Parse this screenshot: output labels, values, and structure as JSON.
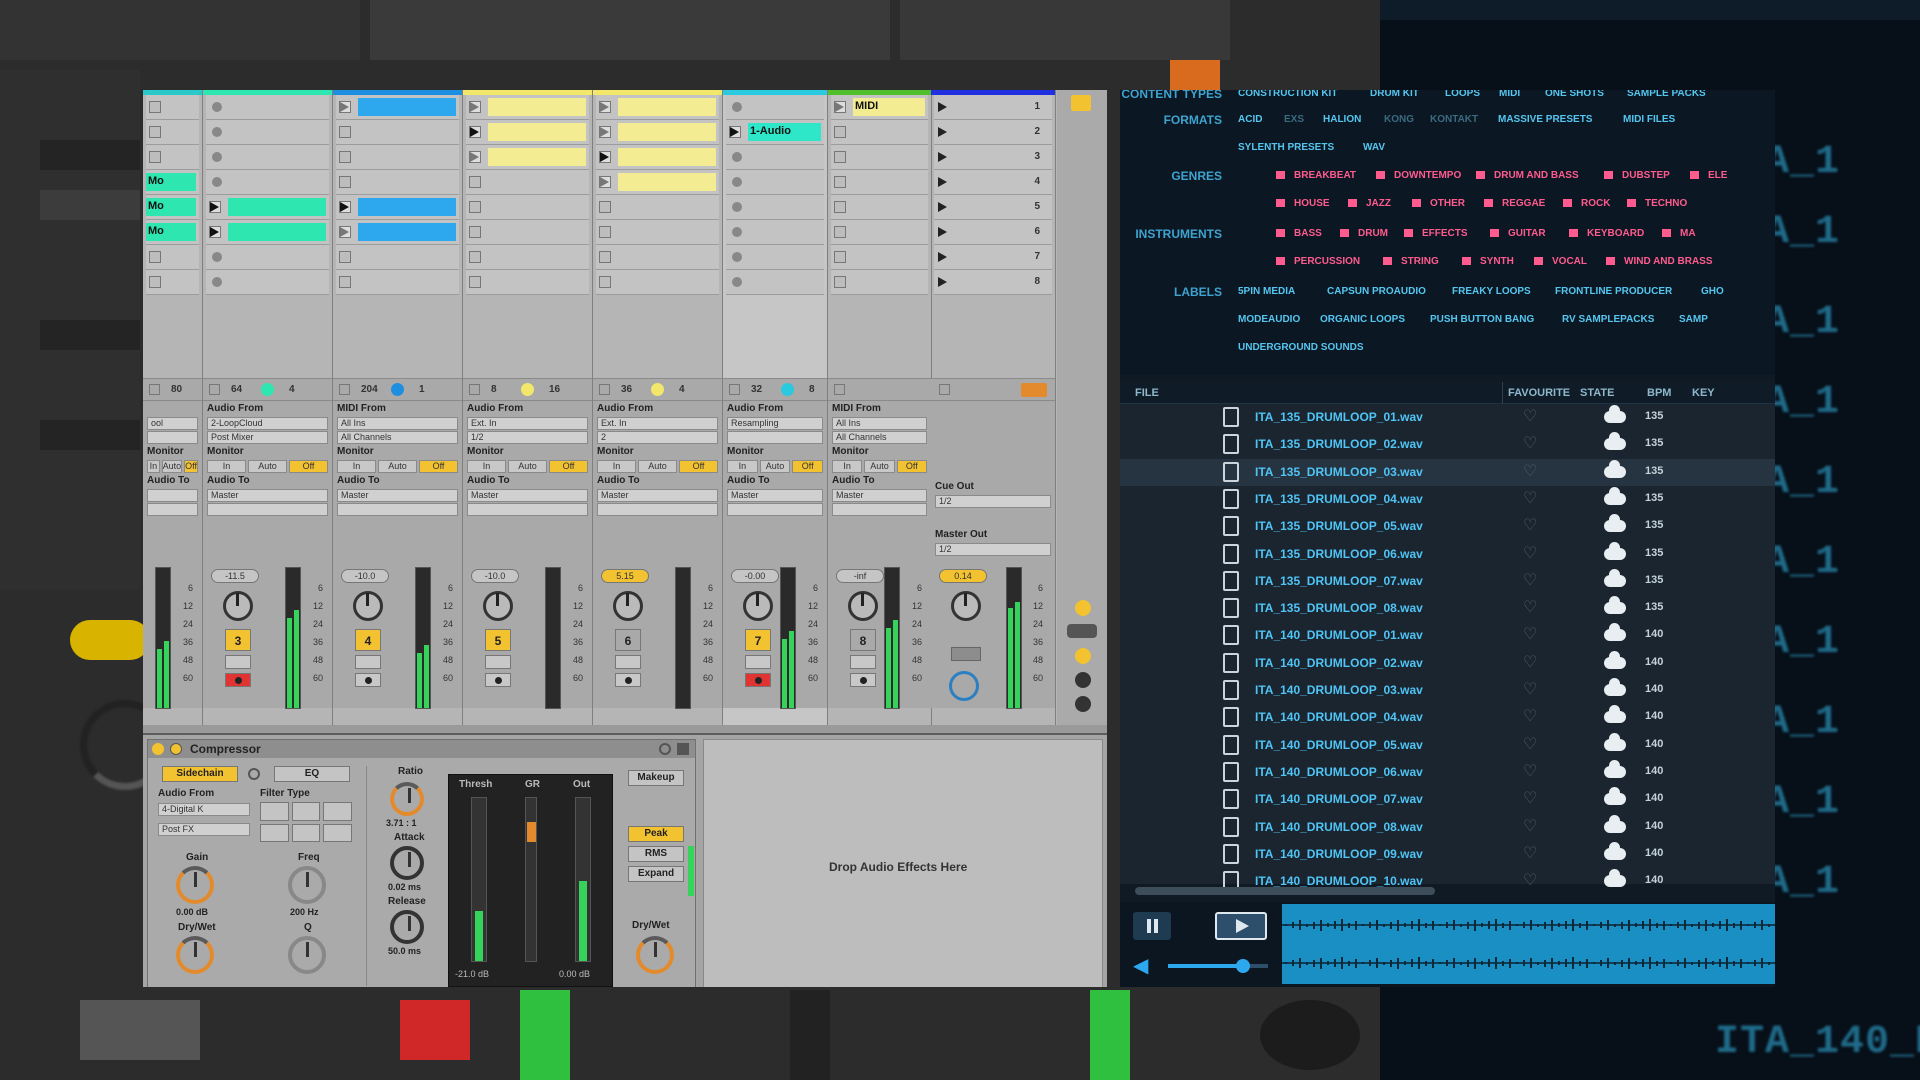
{
  "tracks": [
    {
      "color": "#29c9c9",
      "slots": [
        {
          "type": "empty"
        },
        {
          "type": "empty"
        },
        {
          "type": "empty"
        },
        {
          "type": "clip",
          "color": "#2ee6b0",
          "label": "Mo"
        },
        {
          "type": "clip",
          "color": "#2ee6b0",
          "label": "Mo"
        },
        {
          "type": "clip",
          "color": "#2ee6b0",
          "label": "Mo"
        },
        {
          "type": "empty"
        },
        {
          "type": "empty"
        }
      ],
      "header_num": "80",
      "input_label": "",
      "input_dd": "ool",
      "channel_dd": "",
      "to_dd": "",
      "volume": "",
      "track_num": "",
      "armed": false
    },
    {
      "color": "#2ee6b0",
      "slots": [
        {
          "type": "stop"
        },
        {
          "type": "stop"
        },
        {
          "type": "stop"
        },
        {
          "type": "stop"
        },
        {
          "type": "play",
          "color": "#2ee6b0"
        },
        {
          "type": "play",
          "color": "#2ee6b0"
        },
        {
          "type": "stop"
        },
        {
          "type": "stop"
        }
      ],
      "header_num": "64",
      "header_num2": "4",
      "input_label": "Audio From",
      "input_dd": "2-LoopCloud",
      "channel_dd": "Post Mixer",
      "to_dd": "Master",
      "volume": "-11.5",
      "track_num": "3",
      "armed": true
    },
    {
      "color": "#1e8fe0",
      "slots": [
        {
          "type": "btn",
          "color": "#2da8ee"
        },
        {
          "type": "empty"
        },
        {
          "type": "empty"
        },
        {
          "type": "empty"
        },
        {
          "type": "play",
          "color": "#2da8ee"
        },
        {
          "type": "btn",
          "color": "#2da8ee"
        },
        {
          "type": "empty"
        },
        {
          "type": "empty"
        }
      ],
      "header_num": "204",
      "header_num2": "1",
      "input_label": "MIDI From",
      "input_dd": "All Ins",
      "channel_dd": "All Channels",
      "to_dd": "Master",
      "volume": "-10.0",
      "track_num": "4",
      "armed": false
    },
    {
      "color": "#f2e66b",
      "slots": [
        {
          "type": "btn",
          "color": "#f4ec93"
        },
        {
          "type": "play",
          "color": "#f4ec93"
        },
        {
          "type": "btn",
          "color": "#f4ec93"
        },
        {
          "type": "empty"
        },
        {
          "type": "empty"
        },
        {
          "type": "empty"
        },
        {
          "type": "empty"
        },
        {
          "type": "empty"
        }
      ],
      "header_num": "8",
      "header_num2": "16",
      "input_label": "Audio From",
      "input_dd": "Ext. In",
      "channel_dd": "1/2",
      "to_dd": "Master",
      "volume": "-10.0",
      "track_num": "5",
      "armed": false
    },
    {
      "color": "#f2e66b",
      "slots": [
        {
          "type": "btn",
          "color": "#f4ec93"
        },
        {
          "type": "btn",
          "color": "#f4ec93"
        },
        {
          "type": "play",
          "color": "#f4ec93"
        },
        {
          "type": "btn",
          "color": "#f4ec93"
        },
        {
          "type": "empty"
        },
        {
          "type": "empty"
        },
        {
          "type": "empty"
        },
        {
          "type": "empty"
        }
      ],
      "header_num": "36",
      "header_num2": "4",
      "input_label": "Audio From",
      "input_dd": "Ext. In",
      "channel_dd": "2",
      "to_dd": "Master",
      "volume": "5.15",
      "track_num": "6",
      "armed": false
    },
    {
      "color": "#29c9e0",
      "slots": [
        {
          "type": "stop"
        },
        {
          "type": "play",
          "color": "#2ee6c8",
          "name": "1-Audio"
        },
        {
          "type": "stop"
        },
        {
          "type": "stop"
        },
        {
          "type": "stop"
        },
        {
          "type": "stop"
        },
        {
          "type": "stop"
        },
        {
          "type": "stop"
        }
      ],
      "header_num": "32",
      "header_num2": "8",
      "input_label": "Audio From",
      "input_dd": "Resampling",
      "channel_dd": "",
      "to_dd": "Master",
      "volume": "-0.00",
      "track_num": "7",
      "armed": true
    },
    {
      "color": "#4fbf2e",
      "slots": [
        {
          "type": "btn",
          "color": "#f4ec93",
          "name": "MIDI"
        },
        {
          "type": "empty"
        },
        {
          "type": "empty"
        },
        {
          "type": "empty"
        },
        {
          "type": "empty"
        },
        {
          "type": "empty"
        },
        {
          "type": "empty"
        },
        {
          "type": "empty"
        }
      ],
      "header_num": "",
      "header_num2": "",
      "input_label": "MIDI From",
      "input_dd": "All Ins",
      "channel_dd": "All Channels",
      "to_dd": "Master",
      "volume": "-inf",
      "track_num": "8",
      "armed": false
    }
  ],
  "master": {
    "color": "#2030e0",
    "scenes": [
      "1",
      "2",
      "3",
      "4",
      "5",
      "6",
      "7",
      "8"
    ],
    "cue_label": "Cue Out",
    "cue_dd": "1/2",
    "master_label": "Master Out",
    "master_dd": "1/2",
    "volume": "0.14"
  },
  "monitor": {
    "in": "In",
    "auto": "Auto",
    "off": "Off",
    "label": "Monitor",
    "to_label": "Audio To"
  },
  "scale": [
    "6",
    "12",
    "24",
    "36",
    "48",
    "60"
  ],
  "compressor": {
    "title": "Compressor",
    "sidechain": "Sidechain",
    "audio_from": "Audio From",
    "audio_from_dd": "4-Digital K",
    "post_dd": "Post FX",
    "filter_type": "Filter Type",
    "gain": "Gain",
    "gain_val": "0.00 dB",
    "drywet": "Dry/Wet",
    "freq": "Freq",
    "freq_val": "200 Hz",
    "q": "Q",
    "eq": "EQ",
    "ratio": "Ratio",
    "ratio_val": "3.71 : 1",
    "attack": "Attack",
    "attack_val": "0.02 ms",
    "release": "Release",
    "release_val": "50.0 ms",
    "thresh": "Thresh",
    "gr": "GR",
    "out": "Out",
    "thresh_val": "-21.0 dB",
    "out_val": "0.00 dB",
    "makeup": "Makeup",
    "peak": "Peak",
    "rms": "RMS",
    "expand": "Expand",
    "drywet2": "Dry/Wet"
  },
  "drop_text": "Drop Audio Effects Here",
  "browser": {
    "content_types": "CONTENT TYPES",
    "content_type_tags": [
      "CONSTRUCTION KIT",
      "DRUM KIT",
      "LOOPS",
      "MIDI",
      "ONE SHOTS",
      "SAMPLE PACKS"
    ],
    "formats": "FORMATS",
    "format_tags": [
      {
        "t": "ACID",
        "dim": false
      },
      {
        "t": "EXS",
        "dim": true
      },
      {
        "t": "HALION",
        "dim": false
      },
      {
        "t": "KONG",
        "dim": true
      },
      {
        "t": "KONTAKT",
        "dim": true
      },
      {
        "t": "MASSIVE PRESETS",
        "dim": false
      },
      {
        "t": "MIDI FILES",
        "dim": false
      }
    ],
    "format_tags2": [
      "SYLENTH PRESETS",
      "WAV"
    ],
    "genres": "GENRES",
    "genre_tags": [
      "BREAKBEAT",
      "DOWNTEMPO",
      "DRUM AND BASS",
      "DUBSTEP",
      "ELE"
    ],
    "genre_tags2": [
      "HOUSE",
      "JAZZ",
      "OTHER",
      "REGGAE",
      "ROCK",
      "TECHNO"
    ],
    "instruments": "INSTRUMENTS",
    "inst_tags": [
      "BASS",
      "DRUM",
      "EFFECTS",
      "GUITAR",
      "KEYBOARD",
      "MA"
    ],
    "inst_tags2": [
      "PERCUSSION",
      "STRING",
      "SYNTH",
      "VOCAL",
      "WIND AND BRASS"
    ],
    "labels": "LABELS",
    "label_tags": [
      "5PIN MEDIA",
      "CAPSUN PROAUDIO",
      "FREAKY LOOPS",
      "FRONTLINE PRODUCER",
      "GHO"
    ],
    "label_tags2": [
      "MODEAUDIO",
      "ORGANIC LOOPS",
      "PUSH BUTTON BANG",
      "RV SAMPLEPACKS",
      "SAMP"
    ],
    "label_tags3": [
      "UNDERGROUND SOUNDS"
    ],
    "header": {
      "file": "FILE",
      "favourite": "FAVOURITE",
      "state": "STATE",
      "bpm": "BPM",
      "key": "KEY"
    },
    "files": [
      {
        "name": "ITA_135_DRUMLOOP_01.wav",
        "bpm": "135"
      },
      {
        "name": "ITA_135_DRUMLOOP_02.wav",
        "bpm": "135"
      },
      {
        "name": "ITA_135_DRUMLOOP_03.wav",
        "bpm": "135"
      },
      {
        "name": "ITA_135_DRUMLOOP_04.wav",
        "bpm": "135"
      },
      {
        "name": "ITA_135_DRUMLOOP_05.wav",
        "bpm": "135"
      },
      {
        "name": "ITA_135_DRUMLOOP_06.wav",
        "bpm": "135"
      },
      {
        "name": "ITA_135_DRUMLOOP_07.wav",
        "bpm": "135"
      },
      {
        "name": "ITA_135_DRUMLOOP_08.wav",
        "bpm": "135"
      },
      {
        "name": "ITA_140_DRUMLOOP_01.wav",
        "bpm": "140"
      },
      {
        "name": "ITA_140_DRUMLOOP_02.wav",
        "bpm": "140"
      },
      {
        "name": "ITA_140_DRUMLOOP_03.wav",
        "bpm": "140"
      },
      {
        "name": "ITA_140_DRUMLOOP_04.wav",
        "bpm": "140"
      },
      {
        "name": "ITA_140_DRUMLOOP_05.wav",
        "bpm": "140"
      },
      {
        "name": "ITA_140_DRUMLOOP_06.wav",
        "bpm": "140"
      },
      {
        "name": "ITA_140_DRUMLOOP_07.wav",
        "bpm": "140"
      },
      {
        "name": "ITA_140_DRUMLOOP_08.wav",
        "bpm": "140"
      },
      {
        "name": "ITA_140_DRUMLOOP_09.wav",
        "bpm": "140"
      },
      {
        "name": "ITA_140_DRUMLOOP_10.wav",
        "bpm": "140"
      }
    ],
    "selected_index": 2,
    "volume_level": 0.75
  },
  "background": {
    "right_texts": [
      "ITA_1",
      "ITA_1",
      "ITA_1",
      "ITA_1",
      "ITA_1",
      "ITA_1",
      "ITA_1",
      "ITA_1",
      "ITA_1",
      "ITA_1",
      "ITA_140_D"
    ]
  }
}
